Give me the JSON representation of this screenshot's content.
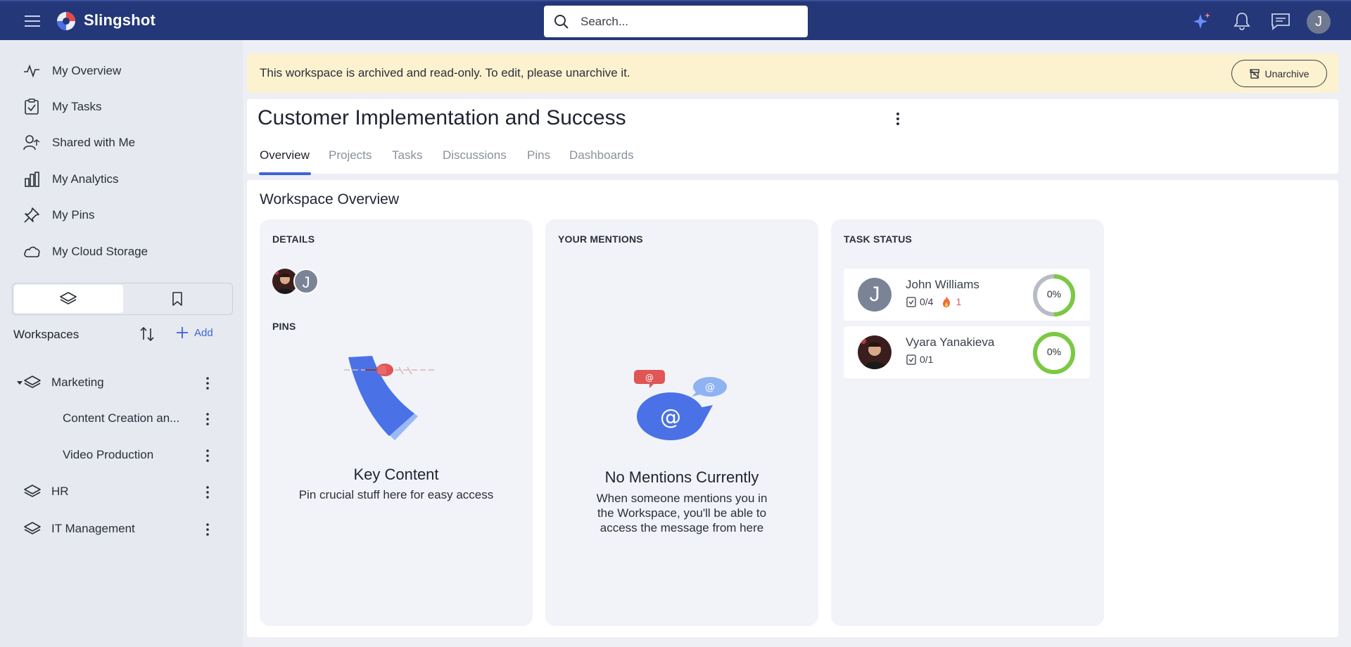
{
  "app": {
    "brand": "Slingshot",
    "search_placeholder": "Search...",
    "user_initial": "J"
  },
  "sidebar": {
    "nav": [
      {
        "label": "My Overview",
        "icon": "activity-icon"
      },
      {
        "label": "My Tasks",
        "icon": "task-check-icon"
      },
      {
        "label": "Shared with Me",
        "icon": "shared-user-icon"
      },
      {
        "label": "My Analytics",
        "icon": "bar-chart-icon"
      },
      {
        "label": "My Pins",
        "icon": "pin-icon"
      },
      {
        "label": "My Cloud Storage",
        "icon": "cloud-icon"
      }
    ],
    "workspaces_title": "Workspaces",
    "add_label": "Add",
    "workspaces": [
      {
        "label": "Marketing",
        "expanded": true
      },
      {
        "label": "Content Creation an..."
      },
      {
        "label": "Video Production"
      },
      {
        "label": "HR"
      },
      {
        "label": "IT Management"
      }
    ]
  },
  "banner": {
    "message": "This workspace is archived and read-only. To edit, please unarchive it.",
    "button_label": "Unarchive"
  },
  "workspace": {
    "title": "Customer Implementation and Success",
    "tabs": [
      "Overview",
      "Projects",
      "Tasks",
      "Discussions",
      "Pins",
      "Dashboards"
    ],
    "active_tab": "Overview"
  },
  "overview": {
    "heading": "Workspace Overview",
    "details": {
      "label": "DETAILS",
      "member_initial": "J",
      "pins_label": "PINS",
      "pins_title": "Key Content",
      "pins_subtitle": "Pin crucial stuff here for easy access"
    },
    "mentions": {
      "label": "YOUR MENTIONS",
      "empty_title": "No Mentions Currently",
      "empty_line1": "When someone mentions you in",
      "empty_line2": "the Workspace, you'll be able to",
      "empty_line3": "access the message from here"
    },
    "task_status": {
      "label": "TASK STATUS",
      "members": [
        {
          "name": "John Williams",
          "initial": "J",
          "tasks": "0/4",
          "overdue": "1",
          "percent": "0%",
          "progress": 0
        },
        {
          "name": "Vyara Yanakieva",
          "tasks": "0/1",
          "percent": "0%",
          "progress": 0
        }
      ]
    }
  },
  "colors": {
    "topbar": "#233779",
    "accent": "#3d63d8",
    "banner_bg": "#fdf2cf",
    "ring_green": "#7ac943",
    "overdue": "#e05a5a"
  }
}
